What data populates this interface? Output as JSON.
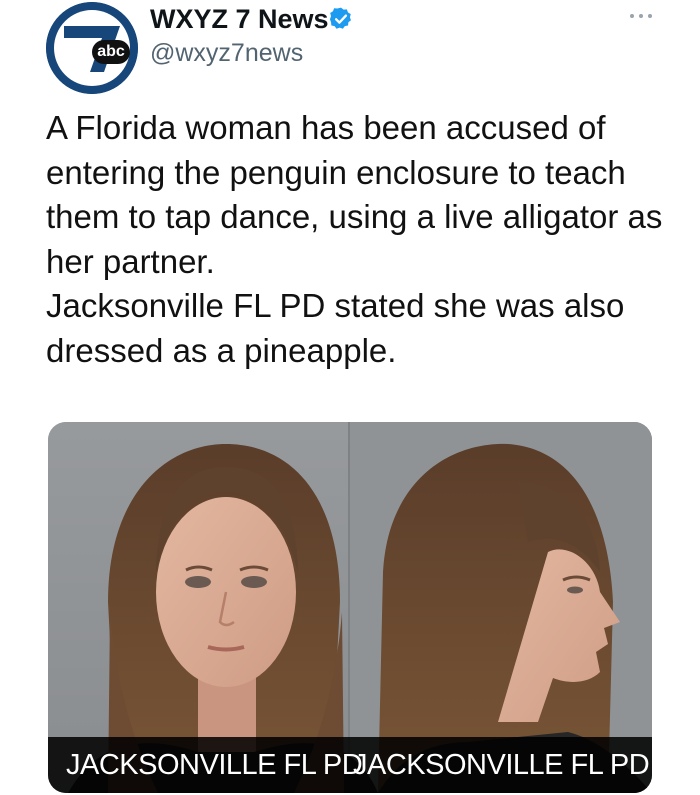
{
  "account": {
    "display_name": "WXYZ 7 News",
    "handle": "@wxyz7news",
    "avatar_badge": "abc",
    "verified": true,
    "avatar_color": "#16467a",
    "verified_color": "#1d9bf0"
  },
  "tweet": {
    "paragraphs": [
      "A Florida woman has been accused of entering the penguin enclosure to teach them to tap dance, using a live alligator as her partner.",
      "Jacksonville FL PD stated she was also dressed as a pineapple."
    ]
  },
  "media": {
    "left_caption": "JACKSONVILLE FL PD",
    "right_caption": "JACKSONVILLE FL PD"
  },
  "icons": {
    "verified": "verified-badge-icon",
    "more": "more-options-icon"
  }
}
